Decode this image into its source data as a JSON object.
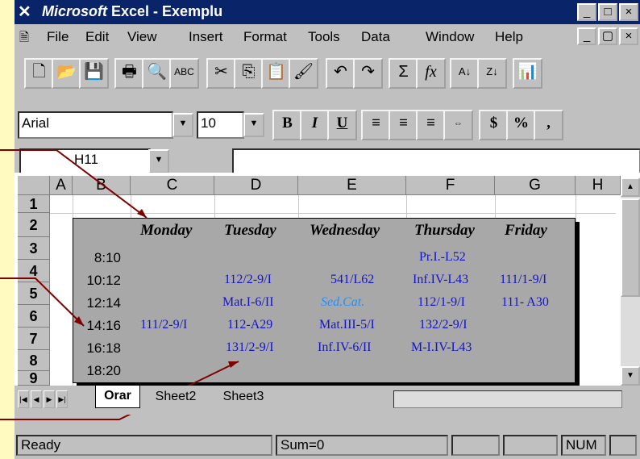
{
  "window": {
    "title_brand": "Microsoft",
    "title_rest": " Excel - Exemplu",
    "buttons": [
      "_",
      "□",
      "×"
    ],
    "doc_buttons": [
      "_",
      "▢",
      "×"
    ]
  },
  "menu": [
    "File",
    "Edit",
    "View",
    "Insert",
    "Format",
    "Tools",
    "Data",
    "Window",
    "Help"
  ],
  "toolbar_icons": [
    "new-icon",
    "open-icon",
    "save-icon",
    "print-icon",
    "print-preview-icon",
    "spelling-icon",
    "cut-icon",
    "copy-icon",
    "paste-icon",
    "format-painter-icon",
    "undo-icon",
    "redo-icon",
    "autosum-icon",
    "function-icon",
    "sort-ascending-icon",
    "sort-descending-icon",
    "chart-wizard-icon"
  ],
  "format": {
    "font": "Arial",
    "size": "10",
    "bold": "B",
    "italic": "I",
    "underline": "U",
    "currency": "$",
    "percent": "%",
    "comma": ","
  },
  "name_box": "H11",
  "columns": [
    "A",
    "B",
    "C",
    "D",
    "E",
    "F",
    "G",
    "H"
  ],
  "rows": [
    "1",
    "2",
    "3",
    "4",
    "5",
    "6",
    "7",
    "8",
    "9"
  ],
  "schedule": {
    "days": [
      "Monday",
      "Tuesday",
      "Wednesday",
      "Thursday",
      "Friday"
    ],
    "times": [
      "8:10",
      "10:12",
      "12:14",
      "14:16",
      "16:18",
      "18:20"
    ],
    "cells": [
      [
        "",
        "",
        "",
        "Pr.I.-L52",
        ""
      ],
      [
        "",
        "112/2-9/I",
        "541/L62",
        "Inf.IV-L43",
        "111/1-9/I"
      ],
      [
        "",
        "Mat.I-6/II",
        "Sed.Cat.",
        "112/1-9/I",
        "111- A30"
      ],
      [
        "111/2-9/I",
        "112-A29",
        "Mat.III-5/I",
        "132/2-9/I",
        ""
      ],
      [
        "",
        "131/2-9/I",
        "Inf.IV-6/II",
        "M-I.IV-L43",
        ""
      ],
      [
        "",
        "",
        "",
        "",
        ""
      ]
    ],
    "highlight_color": "#1e90ff",
    "text_color": "#1414c8"
  },
  "sheets": [
    "Orar",
    "Sheet2",
    "Sheet3"
  ],
  "status": {
    "ready": "Ready",
    "sum": "Sum=0",
    "num": "NUM"
  }
}
